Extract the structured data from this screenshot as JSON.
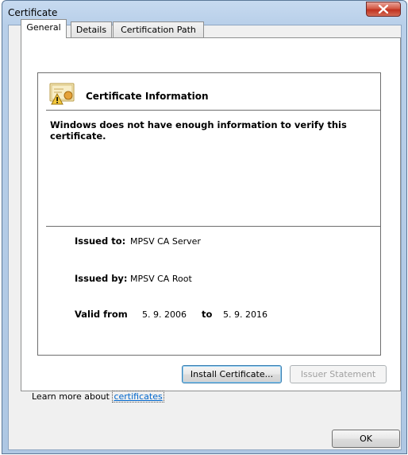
{
  "window": {
    "title": "Certificate"
  },
  "tabs": [
    {
      "label": "General",
      "selected": true
    },
    {
      "label": "Details",
      "selected": false
    },
    {
      "label": "Certification Path",
      "selected": false
    }
  ],
  "general": {
    "header": "Certificate Information",
    "purpose_text": "Windows does not have enough information to verify this certificate.",
    "issued_to_label": "Issued to:",
    "issued_to_value": "MPSV CA Server",
    "issued_by_label": "Issued by:",
    "issued_by_value": "MPSV CA Root",
    "valid_from_label": "Valid from",
    "valid_from_value": "5. 9. 2006",
    "valid_to_label": "to",
    "valid_to_value": "5. 9. 2016",
    "install_button": "Install Certificate...",
    "issuer_button": "Issuer Statement",
    "learn_more_prefix": "Learn more about ",
    "learn_more_link": "certificates"
  },
  "footer": {
    "ok_button": "OK"
  },
  "icons": {
    "close": "close-icon",
    "certificate": "certificate-warning-icon"
  },
  "colors": {
    "link": "#0066cc",
    "close_button": "#c0321f"
  }
}
